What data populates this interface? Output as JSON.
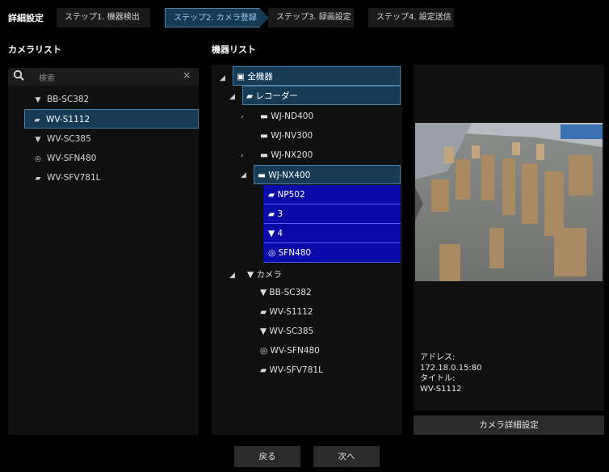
{
  "header": {
    "title": "詳細設定",
    "tabs": [
      {
        "label": "ステップ1. 機器検出"
      },
      {
        "label": "ステップ2. カメラ登録"
      },
      {
        "label": "ステップ3. 録画設定"
      },
      {
        "label": "ステップ4. 設定送信"
      }
    ]
  },
  "camera_list": {
    "heading": "カメラリスト",
    "search_placeholder": "検索",
    "clear_symbol": "×",
    "items": [
      {
        "label": "BB-SC382",
        "icon": "dome-camera-icon",
        "selected": false
      },
      {
        "label": "WV-S1112",
        "icon": "box-camera-icon",
        "selected": true
      },
      {
        "label": "WV-SC385",
        "icon": "dome-camera-icon",
        "selected": false
      },
      {
        "label": "WV-SFN480",
        "icon": "fisheye-camera-icon",
        "selected": false
      },
      {
        "label": "WV-SFV781L",
        "icon": "box-camera-icon",
        "selected": false
      }
    ]
  },
  "device_list": {
    "heading": "機器リスト",
    "root": "全機器",
    "recorder_group": "レコーダー",
    "recorders": [
      "WJ-ND400",
      "WJ-NV300",
      "WJ-NX200",
      "WJ-NX400"
    ],
    "nx400_children": [
      "NP502",
      "3",
      "4",
      "SFN480"
    ],
    "camera_group": "カメラ",
    "cameras": [
      "BB-SC382",
      "WV-S1112",
      "WV-SC385",
      "WV-SFN480",
      "WV-SFV781L"
    ]
  },
  "preview": {
    "address_label": "アドレス:",
    "address_value": "172.18.0.15:80",
    "title_label": "タイトル:",
    "title_value": "WV-S1112",
    "detail_button": "カメラ詳細設定"
  },
  "footer": {
    "back": "戻る",
    "next": "次へ"
  },
  "colors": {
    "selection_bg": "#173a55",
    "selection_border": "#4b7fa6",
    "device_highlight": "#0a0aa8"
  }
}
